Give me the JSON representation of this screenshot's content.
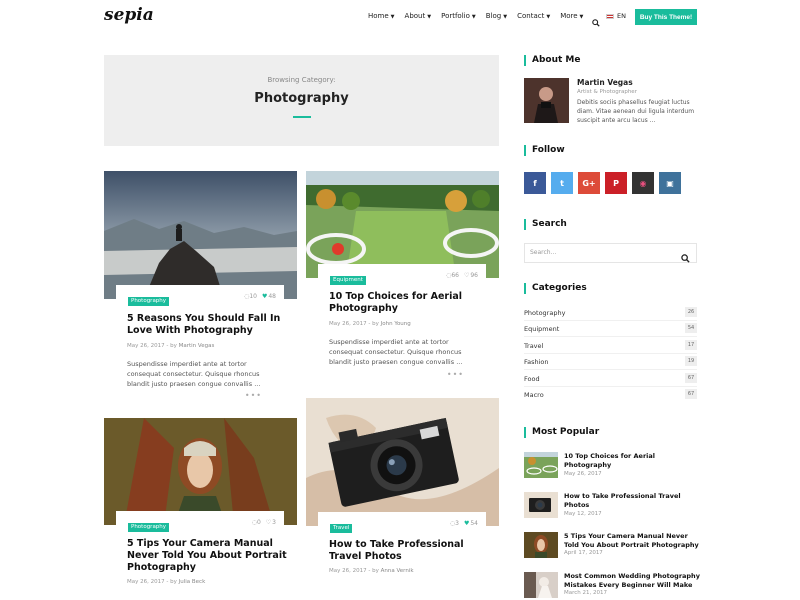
{
  "header": {
    "logo": "sepia",
    "nav": [
      "Home",
      "About",
      "Portfolio",
      "Blog",
      "Contact",
      "More"
    ],
    "lang": "EN",
    "buy_label": "Buy This Theme!"
  },
  "banner": {
    "subtitle": "Browsing Category:",
    "title": "Photography"
  },
  "posts": [
    {
      "category": "Photography",
      "comments": "10",
      "likes": "48",
      "title": "5 Reasons You Should Fall In Love With Photography",
      "date": "May 26, 2017",
      "by": "- by",
      "author": "Martin Vegas",
      "excerpt": "Suspendisse imperdiet ante at tortor consequat consectetur. Quisque rhoncus blandit justo praesen congue convallis ..."
    },
    {
      "category": "Equipment",
      "comments": "66",
      "likes": "96",
      "title": "10 Top Choices for Aerial Photography",
      "date": "May 26, 2017",
      "by": "- by",
      "author": "John Young",
      "excerpt": "Suspendisse imperdiet ante at tortor consequat consectetur. Quisque rhoncus blandit justo praesen congue convallis ..."
    },
    {
      "category": "Photography",
      "comments": "0",
      "likes": "3",
      "title": "5 Tips Your Camera Manual Never Told You About Portrait Photography",
      "date": "May 26, 2017",
      "by": "- by",
      "author": "Julia Beck",
      "excerpt": ""
    },
    {
      "category": "Travel",
      "comments": "3",
      "likes": "54",
      "title": "How to Take Professional Travel Photos",
      "date": "May 26, 2017",
      "by": "- by",
      "author": "Anna Vernik",
      "excerpt": ""
    }
  ],
  "sidebar": {
    "about": {
      "heading": "About Me",
      "name": "Martin Vegas",
      "role": "Artist & Photographer",
      "text": "Debitis sociis phasellus feugiat luctus diam. Vitae aenean dui ligula interdum suscipit ante arcu lacus ..."
    },
    "follow": {
      "heading": "Follow",
      "networks": [
        {
          "name": "facebook-icon",
          "glyph": "f",
          "color": "#3b5998"
        },
        {
          "name": "twitter-icon",
          "glyph": "t",
          "color": "#55acee"
        },
        {
          "name": "google-plus-icon",
          "glyph": "G+",
          "color": "#dd4b39"
        },
        {
          "name": "pinterest-icon",
          "glyph": "P",
          "color": "#cb2027"
        },
        {
          "name": "dribbble-icon",
          "glyph": "◉",
          "color": "#333333"
        },
        {
          "name": "instagram-icon",
          "glyph": "▣",
          "color": "#3f729b"
        }
      ]
    },
    "search": {
      "heading": "Search",
      "placeholder": "Search..."
    },
    "categories": {
      "heading": "Categories",
      "items": [
        {
          "label": "Photography",
          "count": "26"
        },
        {
          "label": "Equipment",
          "count": "54"
        },
        {
          "label": "Travel",
          "count": "17"
        },
        {
          "label": "Fashion",
          "count": "19"
        },
        {
          "label": "Food",
          "count": "67"
        },
        {
          "label": "Macro",
          "count": "67"
        }
      ]
    },
    "popular": {
      "heading": "Most Popular",
      "items": [
        {
          "title": "10 Top Choices for Aerial Photography",
          "date": "May 26, 2017"
        },
        {
          "title": "How to Take Professional Travel Photos",
          "date": "May 12, 2017"
        },
        {
          "title": "5 Tips Your Camera Manual Never Told You About Portrait Photography",
          "date": "April 17, 2017"
        },
        {
          "title": "Most Common Wedding Photography Mistakes Every Beginner Will Make",
          "date": "March 21, 2017"
        }
      ]
    }
  },
  "colors": {
    "accent": "#1abc9c",
    "banner_bg": "#eeeeee"
  }
}
